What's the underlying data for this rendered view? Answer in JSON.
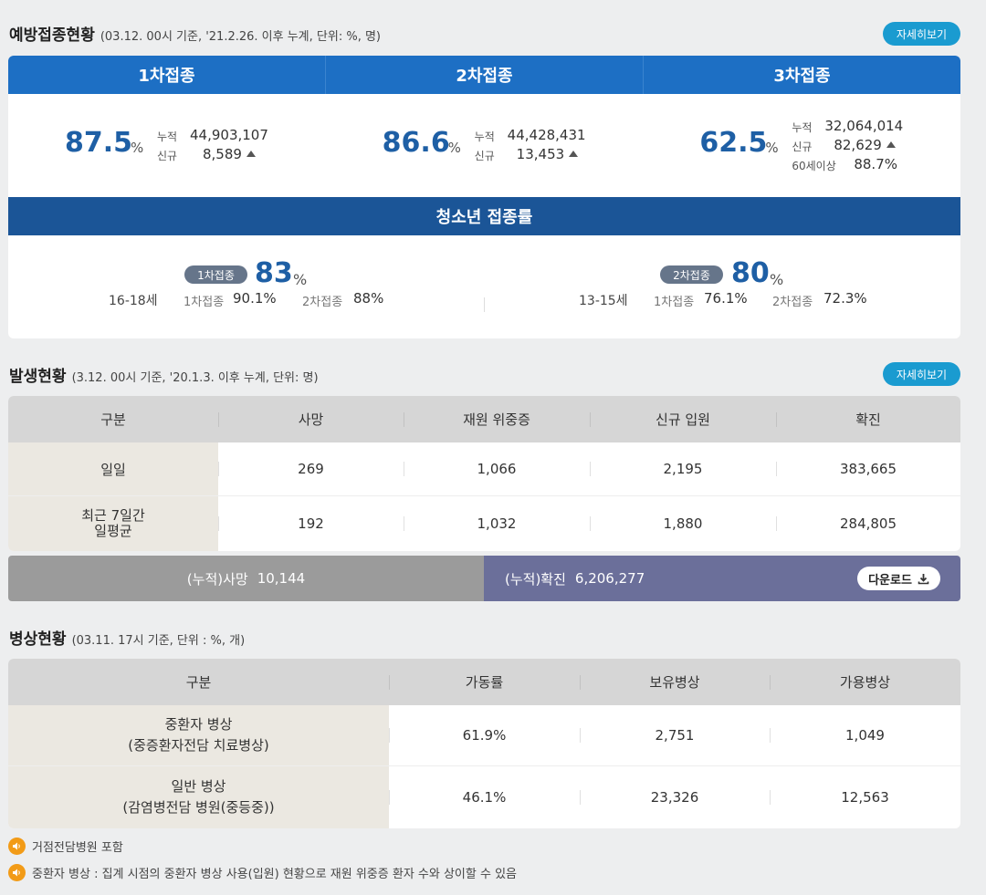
{
  "vaccination": {
    "title": "예방접종현황",
    "subtitle": "(03.12. 00시 기준, '21.2.26. 이후 누계, 단위: %, 명)",
    "detail_label": "자세히보기",
    "doses": [
      {
        "label": "1차접종",
        "rate": "87.5",
        "pct": "%",
        "cum_label": "누적",
        "cum_value": "44,903,107",
        "new_label": "신규",
        "new_value": "8,589"
      },
      {
        "label": "2차접종",
        "rate": "86.6",
        "pct": "%",
        "cum_label": "누적",
        "cum_value": "44,428,431",
        "new_label": "신규",
        "new_value": "13,453"
      },
      {
        "label": "3차접종",
        "rate": "62.5",
        "pct": "%",
        "cum_label": "누적",
        "cum_value": "32,064,014",
        "new_label": "신규",
        "new_value": "82,629",
        "extra_label": "60세이상",
        "extra_value": "88.7%"
      }
    ],
    "teen": {
      "title": "청소년 접종률",
      "groups": [
        {
          "age": "16-18세",
          "pill": "1차접종",
          "rate": "83",
          "pct": "%",
          "d1_label": "1차접종",
          "d1_value": "90.1%",
          "d2_label": "2차접종",
          "d2_value": "88%"
        },
        {
          "age": "13-15세",
          "pill": "2차접종",
          "rate": "80",
          "pct": "%",
          "d1_label": "1차접종",
          "d1_value": "76.1%",
          "d2_label": "2차접종",
          "d2_value": "72.3%"
        }
      ]
    }
  },
  "occurrence": {
    "title": "발생현황",
    "subtitle": "(3.12. 00시 기준, '20.1.3. 이후 누계, 단위: 명)",
    "detail_label": "자세히보기",
    "headers": [
      "구분",
      "사망",
      "재원 위중증",
      "신규 입원",
      "확진"
    ],
    "rows": [
      {
        "label": "일일",
        "values": [
          "269",
          "1,066",
          "2,195",
          "383,665"
        ]
      },
      {
        "label_line1": "최근 7일간",
        "label_line2": "일평균",
        "values": [
          "192",
          "1,032",
          "1,880",
          "284,805"
        ]
      }
    ],
    "cum_death_label": "(누적)사망",
    "cum_death_value": "10,144",
    "cum_conf_label": "(누적)확진",
    "cum_conf_value": "6,206,277",
    "download_label": "다운로드"
  },
  "beds": {
    "title": "병상현황",
    "subtitle": "(03.11. 17시 기준, 단위 : %, 개)",
    "headers": [
      "구분",
      "가동률",
      "보유병상",
      "가용병상"
    ],
    "rows": [
      {
        "label_line1": "중환자 병상",
        "label_line2": "(중증환자전담 치료병상)",
        "values": [
          "61.9%",
          "2,751",
          "1,049"
        ]
      },
      {
        "label_line1": "일반 병상",
        "label_line2": "(감염병전담 병원(중등중))",
        "values": [
          "46.1%",
          "23,326",
          "12,563"
        ]
      }
    ]
  },
  "notes": [
    "거점전담병원 포함",
    "중환자 병상 : 집계 시점의 중환자 병상 사용(입원) 현황으로 재원 위중증 환자 수와 상이할 수 있음"
  ],
  "colors": {
    "primary_blue": "#1d6fc4",
    "teen_blue": "#1b5597",
    "number_blue": "#1e5fa5",
    "detail_button": "#1a9bd0",
    "cum_confirmed": "#6b6f9a",
    "cum_death": "#9b9b9b",
    "note_icon": "#f29b17"
  }
}
